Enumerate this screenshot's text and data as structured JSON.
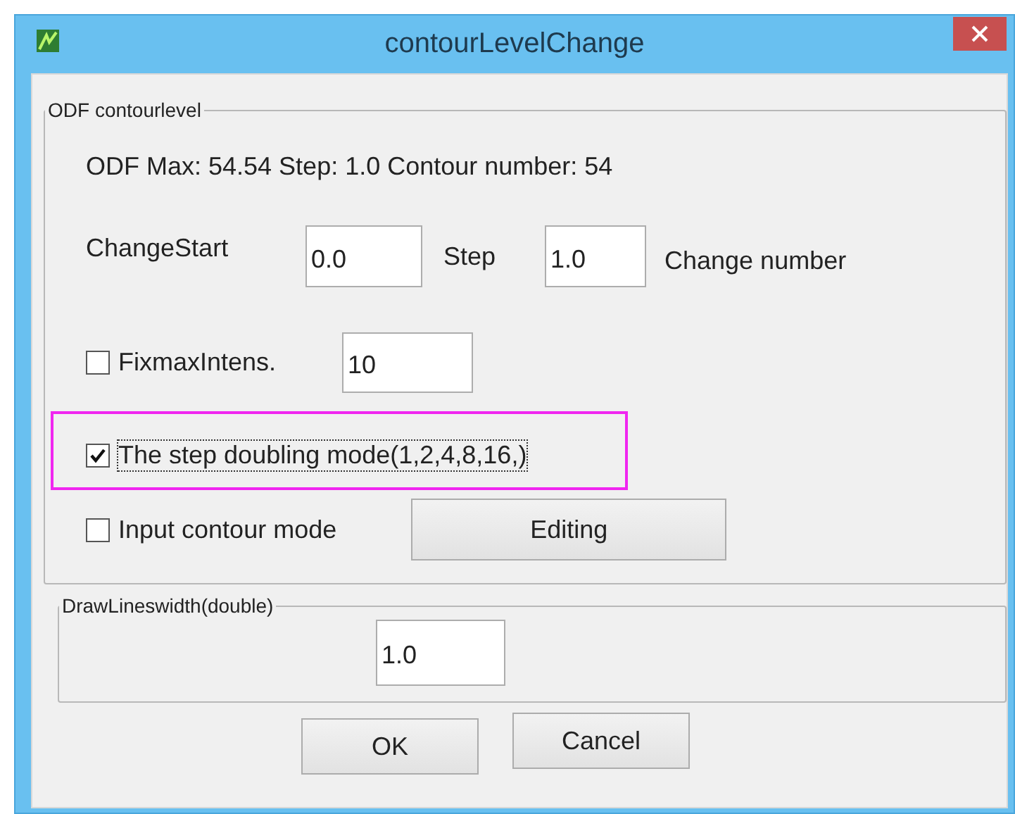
{
  "window": {
    "title": "contourLevelChange"
  },
  "odf_group": {
    "legend": "ODF contourlevel",
    "info": "ODF Max: 54.54 Step: 1.0 Contour number: 54",
    "change_start": {
      "label": "ChangeStart",
      "value": "0.0"
    },
    "step": {
      "label": "Step",
      "value": "1.0"
    },
    "change_number": {
      "label": "Change number"
    },
    "options": [
      {
        "kind": "field",
        "label": "FixmaxIntens.",
        "checked": false,
        "focused": false,
        "highlighted": false,
        "value": "10"
      },
      {
        "kind": "plain",
        "label": "The step doubling mode(1,2,4,8,16,)",
        "checked": true,
        "focused": true,
        "highlighted": true
      },
      {
        "kind": "button",
        "label": "Input contour mode",
        "checked": false,
        "focused": false,
        "highlighted": false,
        "button": "Editing"
      }
    ]
  },
  "line_width_group": {
    "legend": "DrawLineswidth(double)",
    "value": "1.0"
  },
  "buttons": [
    {
      "label": "OK"
    },
    {
      "label": "Cancel"
    }
  ]
}
